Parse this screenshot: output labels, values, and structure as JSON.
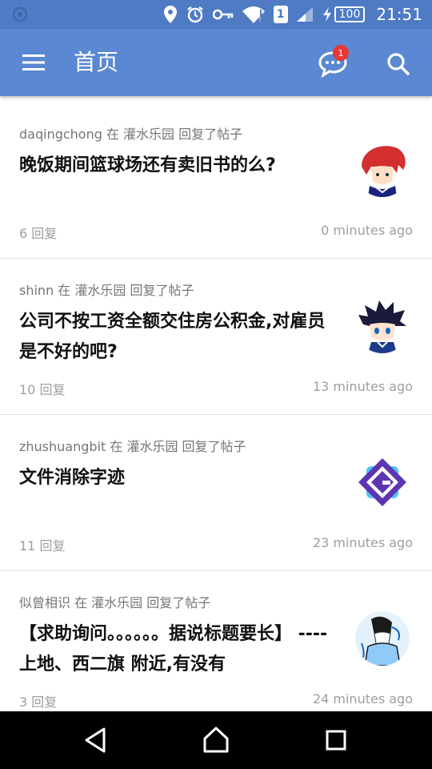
{
  "status_bar": {
    "battery": "100",
    "time": "21:51",
    "sim_slot": "1"
  },
  "app_bar": {
    "title": "首页",
    "notification_count": "1"
  },
  "posts": [
    {
      "meta": "daqingchong 在 灌水乐园 回复了帖子",
      "title": "晚饭期间篮球场还有卖旧书的么?",
      "replies": "6 回复",
      "time": "0 minutes ago",
      "avatar": "red-hair-anime-avatar"
    },
    {
      "meta": "shinn 在 灌水乐园 回复了帖子",
      "title": "公司不按工资全额交住房公积金,对雇员是不好的吧?",
      "replies": "10 回复",
      "time": "13 minutes ago",
      "avatar": "blue-hair-anime-avatar"
    },
    {
      "meta": "zhushuangbit 在 灌水乐园 回复了帖子",
      "title": "文件消除字迹",
      "replies": "11 回复",
      "time": "23 minutes ago",
      "avatar": "purple-diamond-logo-avatar"
    },
    {
      "meta": "似曾相识 在 灌水乐园 回复了帖子",
      "title": "【求助询问。。。。。。据说标题要长】 ----上地、西二旗 附近,有没有",
      "replies": "3 回复",
      "time": "24 minutes ago",
      "avatar": "sketch-character-avatar"
    }
  ],
  "colors": {
    "status_bar": "#4f7bc5",
    "app_bar": "#5a88d2",
    "badge": "#e53935",
    "meta_text": "#757575",
    "muted_text": "#9e9e9e"
  }
}
